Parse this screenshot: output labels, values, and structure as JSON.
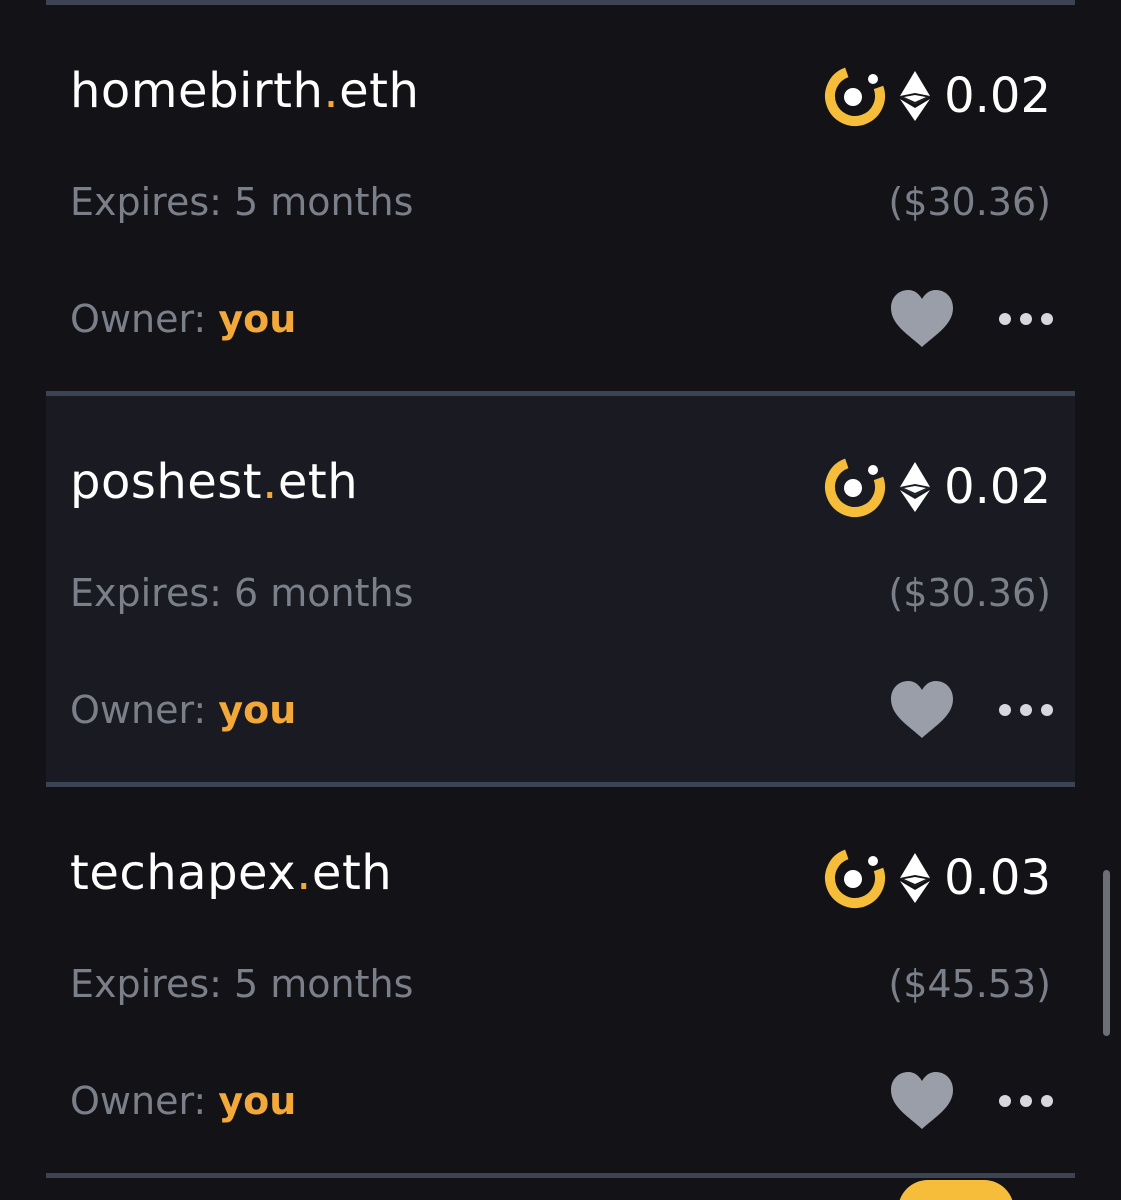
{
  "colors": {
    "background": "#131317",
    "highlight_background": "#1a1b22",
    "divider": "#3c4352",
    "accent": "#f3a93a",
    "muted_text": "#7a7f89"
  },
  "listings": [
    {
      "name": "homebirth",
      "dot": ".",
      "tld": "eth",
      "price": "0.02",
      "expires": "Expires: 5 months",
      "usd": "($30.36)",
      "owner_label": "Owner:",
      "owner_value": "you",
      "marketplace_icon": "marketplace-logo-icon",
      "currency_icon": "ethereum-icon"
    },
    {
      "name": "poshest",
      "dot": ".",
      "tld": "eth",
      "price": "0.02",
      "expires": "Expires: 6 months",
      "usd": "($30.36)",
      "owner_label": "Owner:",
      "owner_value": "you",
      "marketplace_icon": "marketplace-logo-icon",
      "currency_icon": "ethereum-icon"
    },
    {
      "name": "techapex",
      "dot": ".",
      "tld": "eth",
      "price": "0.03",
      "expires": "Expires: 5 months",
      "usd": "($45.53)",
      "owner_label": "Owner:",
      "owner_value": "you",
      "marketplace_icon": "marketplace-logo-icon",
      "currency_icon": "ethereum-icon"
    }
  ]
}
